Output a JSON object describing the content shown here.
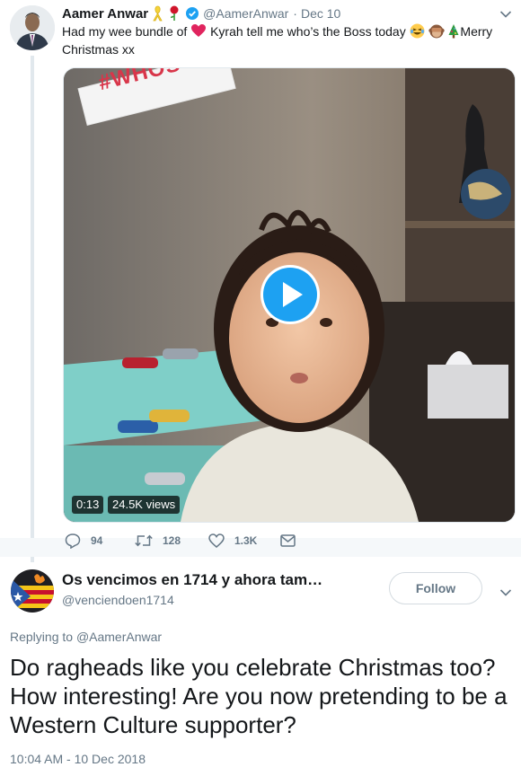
{
  "tweet1": {
    "name": "Aamer Anwar",
    "handle": "@AamerAnwar",
    "separator": "·",
    "date": "Dec 10",
    "text_before_heart": "Had my wee bundle of",
    "text_after_heart": "Kyrah tell me who’s the Boss today",
    "text_end": "Merry Christmas xx",
    "video": {
      "overlay_text": "#WHOS",
      "duration": "0:13",
      "views": "24.5K views"
    },
    "actions": {
      "replies": "94",
      "retweets": "128",
      "likes": "1.3K"
    }
  },
  "tweet2": {
    "name": "Os vencimos en 1714 y ahora tam…",
    "handle": "@venciendoen1714",
    "follow_label": "Follow",
    "replying_prefix": "Replying to",
    "replying_handle": "@AamerAnwar",
    "text": "Do ragheads like you celebrate Christmas too? How interesting! Are you now pretending to be a Western Culture supporter?",
    "timestamp": "10:04 AM - 10 Dec 2018"
  },
  "colors": {
    "primary_text": "#14171a",
    "secondary_text": "#657786",
    "link": "#1da1f2",
    "border": "#e1e8ed",
    "verified": "#1da1f2",
    "heart_emoji": "#e0245e"
  },
  "icons": [
    "ribbon-icon",
    "rose-icon",
    "verified-badge-icon",
    "heart-emoji-icon",
    "laughing-emoji-icon",
    "monkey-emoji-icon",
    "christmas-tree-emoji-icon",
    "play-icon",
    "reply-icon",
    "retweet-icon",
    "like-icon",
    "dm-icon",
    "chevron-down-icon"
  ]
}
